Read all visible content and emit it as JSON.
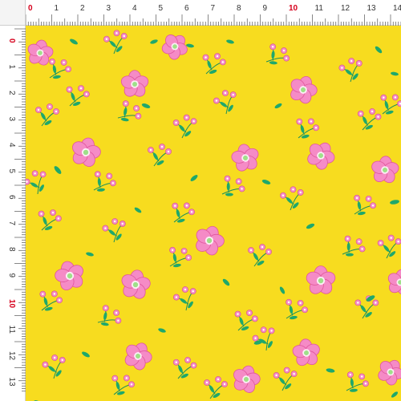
{
  "ruler": {
    "unit": "cm",
    "top_labels": [
      "0",
      "1",
      "2",
      "3",
      "4",
      "5",
      "6",
      "7",
      "8",
      "9",
      "10",
      "11",
      "12",
      "13",
      "14"
    ],
    "left_labels": [
      "0",
      "1",
      "2",
      "3",
      "4",
      "5",
      "6",
      "7",
      "8",
      "9",
      "10",
      "11",
      "12",
      "13"
    ],
    "highlight_labels": [
      "0",
      "10"
    ],
    "highlight_color": "#d6001c"
  },
  "fabric": {
    "background_color": "#f7dc1f",
    "pattern": "pink flowers with green leaves",
    "flower_color": "#f58bc6",
    "flower_center_color": "#9fe08a",
    "leaf_color": "#1fa86b"
  }
}
